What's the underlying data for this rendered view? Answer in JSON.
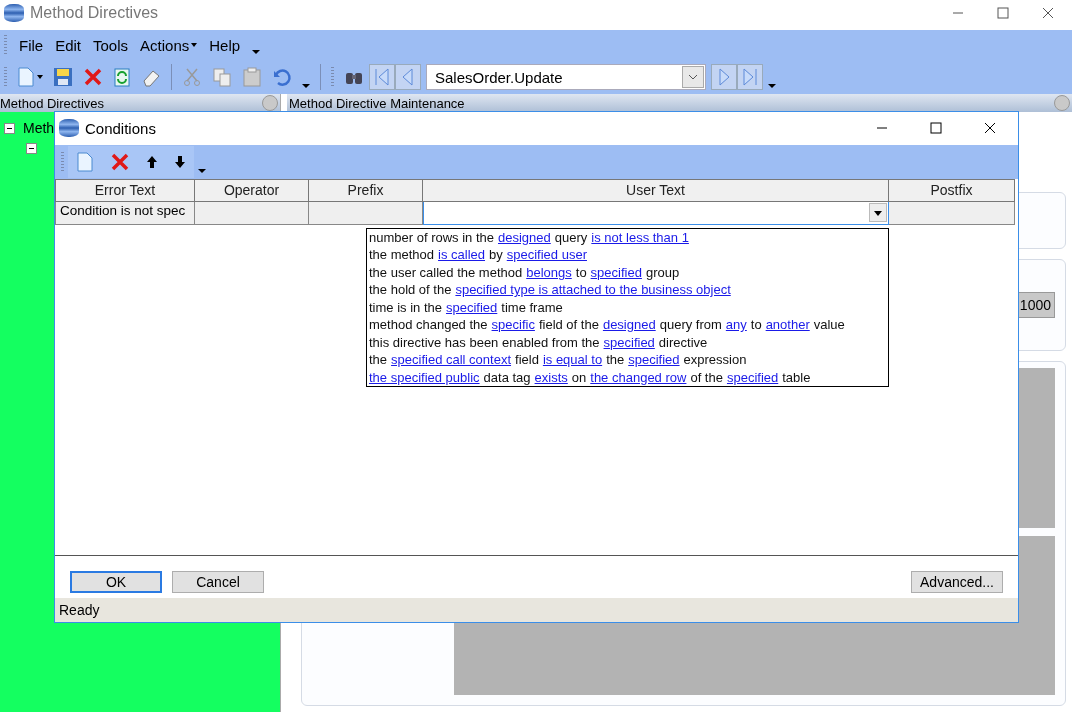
{
  "window": {
    "title": "Method Directives"
  },
  "menu": [
    {
      "label": "File",
      "has_arrow": false
    },
    {
      "label": "Edit",
      "has_arrow": false
    },
    {
      "label": "Tools",
      "has_arrow": false
    },
    {
      "label": "Actions",
      "has_arrow": true
    },
    {
      "label": "Help",
      "has_arrow": false
    }
  ],
  "navigator": {
    "value": "SalesOrder.Update"
  },
  "left_panel": {
    "title": "Method Directives",
    "tree_item": "Meth"
  },
  "right_panel": {
    "title": "Method Directive Maintenance",
    "field_value": "1000"
  },
  "dialog": {
    "title": "Conditions",
    "table": {
      "columns": [
        "Error Text",
        "Operator",
        "Prefix",
        "User Text",
        "Postfix"
      ],
      "rows": [
        [
          "Condition is not spec",
          "",
          "",
          "",
          ""
        ]
      ]
    },
    "dropdown_options": [
      [
        {
          "kind": "text",
          "text": "number of rows in the"
        },
        {
          "kind": "link",
          "text": "designed"
        },
        {
          "kind": "text",
          "text": "query"
        },
        {
          "kind": "link",
          "text": "is not less than 1"
        }
      ],
      [
        {
          "kind": "text",
          "text": "the method"
        },
        {
          "kind": "link",
          "text": "is called"
        },
        {
          "kind": "text",
          "text": "by"
        },
        {
          "kind": "link",
          "text": "specified user"
        }
      ],
      [
        {
          "kind": "text",
          "text": "the user called the method"
        },
        {
          "kind": "link",
          "text": "belongs"
        },
        {
          "kind": "text",
          "text": "to"
        },
        {
          "kind": "link",
          "text": "specified"
        },
        {
          "kind": "text",
          "text": "group"
        }
      ],
      [
        {
          "kind": "text",
          "text": "the hold of the"
        },
        {
          "kind": "link",
          "text": "specified type is attached to the business object"
        }
      ],
      [
        {
          "kind": "text",
          "text": "time is in the"
        },
        {
          "kind": "link",
          "text": "specified"
        },
        {
          "kind": "text",
          "text": "time frame"
        }
      ],
      [
        {
          "kind": "text",
          "text": "method changed the"
        },
        {
          "kind": "link",
          "text": "specific"
        },
        {
          "kind": "text",
          "text": "field of the"
        },
        {
          "kind": "link",
          "text": "designed"
        },
        {
          "kind": "text",
          "text": "query from"
        },
        {
          "kind": "link",
          "text": "any"
        },
        {
          "kind": "text",
          "text": "to"
        },
        {
          "kind": "link",
          "text": "another"
        },
        {
          "kind": "text",
          "text": "value"
        }
      ],
      [
        {
          "kind": "text",
          "text": "this directive has been enabled from the"
        },
        {
          "kind": "link",
          "text": "specified"
        },
        {
          "kind": "text",
          "text": "directive"
        }
      ],
      [
        {
          "kind": "text",
          "text": "the"
        },
        {
          "kind": "link",
          "text": "specified call context"
        },
        {
          "kind": "text",
          "text": "field"
        },
        {
          "kind": "link",
          "text": "is equal to"
        },
        {
          "kind": "text",
          "text": "the"
        },
        {
          "kind": "link",
          "text": "specified"
        },
        {
          "kind": "text",
          "text": "expression"
        }
      ],
      [
        {
          "kind": "link",
          "text": "the specified public"
        },
        {
          "kind": "text",
          "text": "data tag"
        },
        {
          "kind": "link",
          "text": "exists"
        },
        {
          "kind": "text",
          "text": "on"
        },
        {
          "kind": "link",
          "text": "the changed row"
        },
        {
          "kind": "text",
          "text": "of the"
        },
        {
          "kind": "link",
          "text": "specified"
        },
        {
          "kind": "text",
          "text": "table"
        }
      ]
    ],
    "buttons": [
      {
        "label": "OK",
        "focused": true
      },
      {
        "label": "Cancel",
        "focused": false
      },
      {
        "label": "Advanced...",
        "focused": false
      }
    ],
    "status_bar": "Ready"
  }
}
